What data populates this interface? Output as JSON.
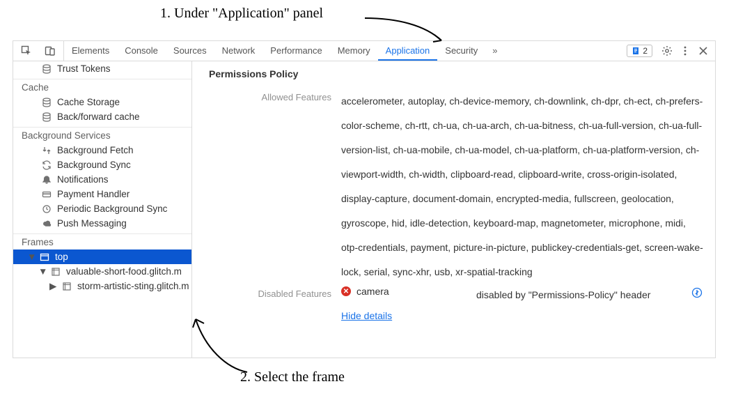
{
  "annotations": {
    "step1": "1. Under \"Application\" panel",
    "step2": "2. Select the frame"
  },
  "tabs": {
    "elements": "Elements",
    "console": "Console",
    "sources": "Sources",
    "network": "Network",
    "performance": "Performance",
    "memory": "Memory",
    "application": "Application",
    "security": "Security",
    "more": "»"
  },
  "issues": {
    "count": "2"
  },
  "sidebar": {
    "trust_tokens": "Trust Tokens",
    "cache_section": "Cache",
    "cache_storage": "Cache Storage",
    "bf_cache": "Back/forward cache",
    "bg_section": "Background Services",
    "bg_fetch": "Background Fetch",
    "bg_sync": "Background Sync",
    "notifications": "Notifications",
    "payment": "Payment Handler",
    "periodic": "Periodic Background Sync",
    "push": "Push Messaging",
    "frames_section": "Frames",
    "frame_top": "top",
    "frame_child1": "valuable-short-food.glitch.m",
    "frame_child2": "storm-artistic-sting.glitch.m"
  },
  "main": {
    "title": "Permissions Policy",
    "allowed_label": "Allowed Features",
    "allowed_list": "accelerometer, autoplay, ch-device-memory, ch-downlink, ch-dpr, ch-ect, ch-prefers-color-scheme, ch-rtt, ch-ua, ch-ua-arch, ch-ua-bitness, ch-ua-full-version, ch-ua-full-version-list, ch-ua-mobile, ch-ua-model, ch-ua-platform, ch-ua-platform-version, ch-viewport-width, ch-width, clipboard-read, clipboard-write, cross-origin-isolated, display-capture, document-domain, encrypted-media, fullscreen, geolocation, gyroscope, hid, idle-detection, keyboard-map, magnetometer, microphone, midi, otp-credentials, payment, picture-in-picture, publickey-credentials-get, screen-wake-lock, serial, sync-xhr, usb, xr-spatial-tracking",
    "disabled_label": "Disabled Features",
    "disabled_feature": "camera",
    "disabled_reason": "disabled by \"Permissions-Policy\" header",
    "hide_details": "Hide details"
  }
}
